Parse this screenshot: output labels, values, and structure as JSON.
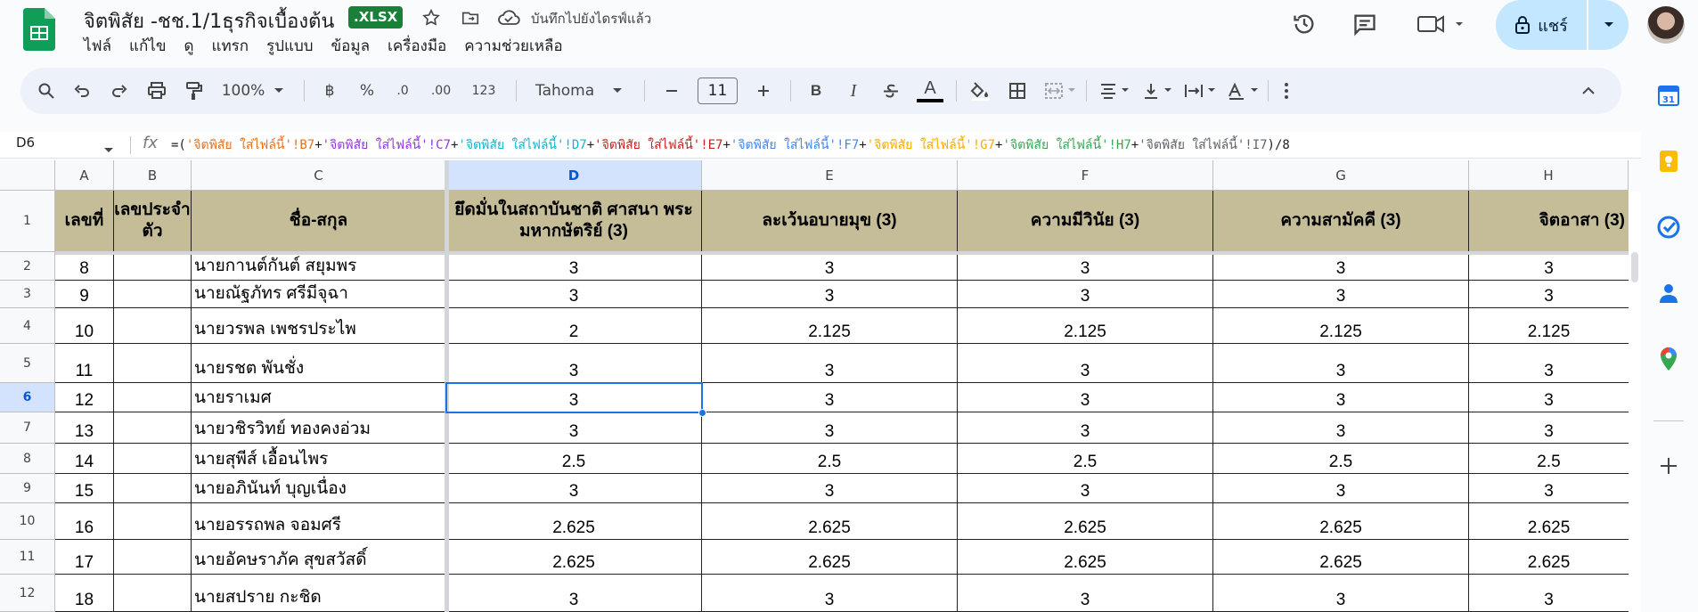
{
  "header": {
    "title": "จิตพิสัย -ชช.1/1ธุรกิจเบื้องต้น",
    "file_badge": ".XLSX",
    "save_status": "บันทึกไปยังไดรฟ์แล้ว",
    "share_label": "แชร์",
    "menu": [
      "ไฟล์",
      "แก้ไข",
      "ดู",
      "แทรก",
      "รูปแบบ",
      "ข้อมูล",
      "เครื่องมือ",
      "ความช่วยเหลือ"
    ]
  },
  "toolbar": {
    "zoom": "100%",
    "currency": "฿",
    "percent": "%",
    "dec_decrease": ".0",
    "dec_increase": ".00",
    "number_format": "123",
    "font": "Tahoma",
    "font_size": "11",
    "bold": "B",
    "italic": "I",
    "text_color": "A"
  },
  "formula_bar": {
    "cell_ref": "D6",
    "fx": "fx",
    "parts": [
      {
        "t": "=(",
        "c": "#1f1f1f"
      },
      {
        "t": "'จิตพิสัย ใส่ไฟล์นี้'!B7",
        "c": "#e7711b"
      },
      {
        "t": "+",
        "c": "#1f1f1f"
      },
      {
        "t": "'จิตพิสัย ใส่ไฟล์นี้'!C7",
        "c": "#9334e6"
      },
      {
        "t": "+",
        "c": "#1f1f1f"
      },
      {
        "t": "'จิตพิสัย ใส่ไฟล์นี้'!D7",
        "c": "#12b5cb"
      },
      {
        "t": "+",
        "c": "#1f1f1f"
      },
      {
        "t": "'จิตพิสัย ใส่ไฟล์นี้'!E7",
        "c": "#c5221f"
      },
      {
        "t": "+",
        "c": "#1f1f1f"
      },
      {
        "t": "'จิตพิสัย ใส่ไฟล์นี้'!F7",
        "c": "#4285f4"
      },
      {
        "t": "+",
        "c": "#1f1f1f"
      },
      {
        "t": "'จิตพิสัย ใส่ไฟล์นี้'!G7",
        "c": "#f9ab00"
      },
      {
        "t": "+",
        "c": "#1f1f1f"
      },
      {
        "t": "'จิตพิสัย ใส่ไฟล์นี้'!H7",
        "c": "#34a853"
      },
      {
        "t": "+",
        "c": "#1f1f1f"
      },
      {
        "t": "'จิตพิสัย ใส่ไฟล์นี้'!I7",
        "c": "#5f6368"
      },
      {
        "t": ")/8",
        "c": "#1f1f1f"
      }
    ]
  },
  "grid": {
    "column_letters": [
      "A",
      "B",
      "C",
      "D",
      "E",
      "F",
      "G",
      "H"
    ],
    "selected_column": "D",
    "selected_row": "6",
    "header_row": {
      "row_number": "1",
      "cells": [
        "เลขที่",
        "เลขประจำตัว",
        "ชื่อ-สกุล",
        "ยึดมั่นในสถาบันชาติ ศาสนา พระมหากษัตริย์ (3)",
        "ละเว้นอบายมุข (3)",
        "ความมีวินัย (3)",
        "ความสามัคคี (3)",
        "จิตอาสา (3)"
      ]
    },
    "rows": [
      {
        "row": "2",
        "cells": [
          "8",
          "",
          "นายกานต์กันต์  สยุมพร",
          "3",
          "3",
          "3",
          "3",
          "3"
        ]
      },
      {
        "row": "3",
        "cells": [
          "9",
          "",
          "นายณัฐภัทร  ศรีมีจุฉา",
          "3",
          "3",
          "3",
          "3",
          "3"
        ]
      },
      {
        "row": "4",
        "cells": [
          "10",
          "",
          "นายวรพล  เพชรประไพ",
          "2",
          "2.125",
          "2.125",
          "2.125",
          "2.125"
        ]
      },
      {
        "row": "5",
        "cells": [
          "11",
          "",
          "นายรชต  พันชั่ง",
          "3",
          "3",
          "3",
          "3",
          "3"
        ]
      },
      {
        "row": "6",
        "cells": [
          "12",
          "",
          "นายราเมศ",
          "3",
          "3",
          "3",
          "3",
          "3"
        ]
      },
      {
        "row": "7",
        "cells": [
          "13",
          "",
          "นายวชิรวิทย์  ทองคงอ่วม",
          "3",
          "3",
          "3",
          "3",
          "3"
        ]
      },
      {
        "row": "8",
        "cells": [
          "14",
          "",
          "นายสุพีส์  เอื้อนไพร",
          "2.5",
          "2.5",
          "2.5",
          "2.5",
          "2.5"
        ]
      },
      {
        "row": "9",
        "cells": [
          "15",
          "",
          "นายอภินันท์  บุญเนื่อง",
          "3",
          "3",
          "3",
          "3",
          "3"
        ]
      },
      {
        "row": "10",
        "cells": [
          "16",
          "",
          "นายอรรถพล  จอมศรี",
          "2.625",
          "2.625",
          "2.625",
          "2.625",
          "2.625"
        ]
      },
      {
        "row": "11",
        "cells": [
          "17",
          "",
          "นายอัคษราภัค  สุขสวัสดิ์",
          "2.625",
          "2.625",
          "2.625",
          "2.625",
          "2.625"
        ]
      },
      {
        "row": "12",
        "cells": [
          "18",
          "",
          "นายสปราย  กะชิด",
          "3",
          "3",
          "3",
          "3",
          "3"
        ]
      }
    ]
  },
  "colors": {
    "header_fill": "#c5bd98",
    "accent": "#1a73e8",
    "share_bg": "#c2e7ff",
    "badge": "#188038"
  }
}
